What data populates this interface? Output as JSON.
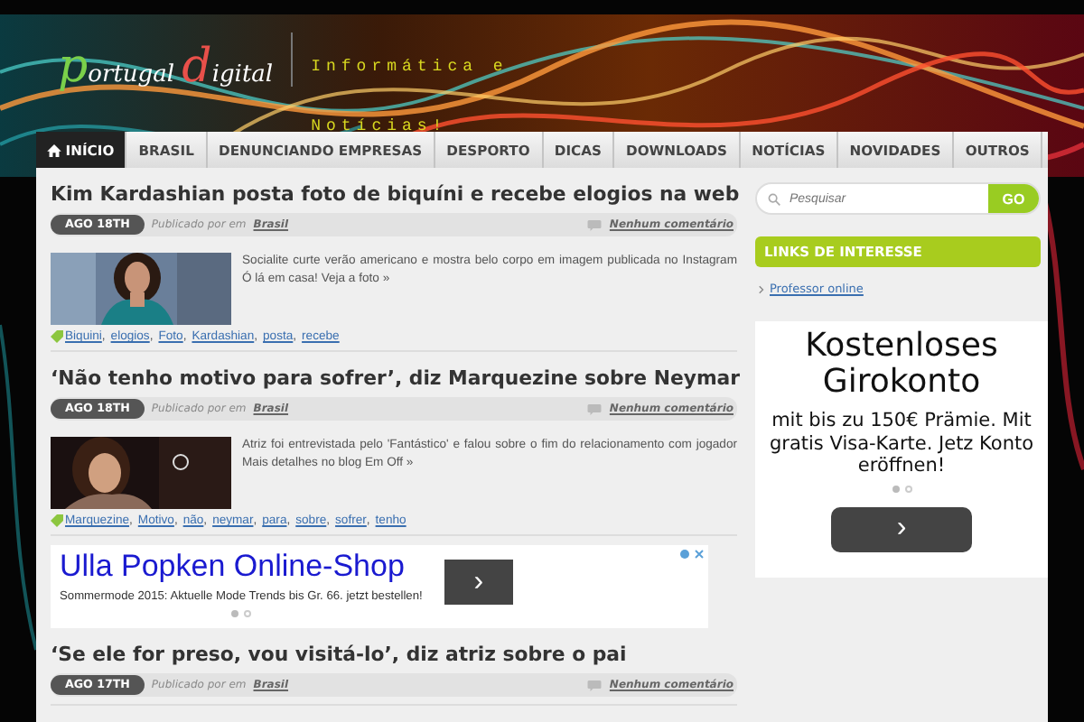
{
  "header": {
    "logo": {
      "word_1_initial": "p",
      "word_1_rest": "ortugal",
      "word_2_initial": "d",
      "word_2_rest": "igital"
    },
    "tagline": [
      "Informática e",
      "Notícias!"
    ]
  },
  "nav": [
    {
      "label": "INÍCIO",
      "selected": true,
      "kind": "home"
    },
    {
      "label": "BRASIL",
      "selected": false
    },
    {
      "label": "DENUNCIANDO EMPRESAS",
      "selected": false
    },
    {
      "label": "DESPORTO",
      "selected": false
    },
    {
      "label": "DICAS",
      "selected": false
    },
    {
      "label": "DOWNLOADS",
      "selected": false
    },
    {
      "label": "NOTÍCIAS",
      "selected": false
    },
    {
      "label": "NOVIDADES",
      "selected": false
    },
    {
      "label": "OUTROS",
      "selected": false
    }
  ],
  "posts": [
    {
      "kind": "post",
      "title": "Kim Kardashian posta foto de biquíni e recebe elogios na web",
      "date": "AGO 18TH",
      "byline": "Publicado por em",
      "category": "Brasil",
      "comments": "Nenhum comentário",
      "excerpt": "Socialite curte verão americano e mostra belo corpo em imagem publicada no Instagram Ó lá em casa! Veja a foto »",
      "tag_separator": ",",
      "tags": [
        "Biquini",
        "elogios",
        "Foto",
        "Kardashian",
        "posta",
        "recebe"
      ]
    },
    {
      "kind": "post",
      "title": "‘Não tenho motivo para sofrer’, diz Marquezine sobre Neymar",
      "date": "AGO 18TH",
      "byline": "Publicado por em",
      "category": "Brasil",
      "comments": "Nenhum comentário",
      "excerpt": "Atriz foi entrevistada pelo 'Fantástico' e falou sobre o fim do relacionamento com jogador Mais detalhes no blog Em Off »",
      "tag_separator": ",",
      "tags": [
        "Marquezine",
        "Motivo",
        "não",
        "neymar",
        "para",
        "sobre",
        "sofrer",
        "tenho"
      ]
    },
    {
      "kind": "ad",
      "title": "Ulla Popken Online-Shop",
      "text": "Sommermode 2015: Aktuelle Mode Trends bis Gr. 66. jetzt bestellen!",
      "button": "›",
      "dots": [
        {
          "selected": true
        },
        {
          "selected": false
        }
      ]
    },
    {
      "kind": "post",
      "title": "‘Se ele for preso, vou visitá-lo’, diz atriz sobre o pai",
      "date": "AGO 17TH",
      "byline": "Publicado por em",
      "category": "Brasil",
      "comments": "Nenhum comentário"
    }
  ],
  "sidebar": {
    "search": {
      "placeholder": "Pesquisar",
      "button": "GO"
    },
    "widget": {
      "title": "LINKS DE INTERESSE",
      "links": [
        "Professor online"
      ]
    },
    "ad": {
      "title": "Kostenloses Girokonto",
      "text": "mit bis zu 150€ Prämie. Mit gratis Visa-Karte. Jetz Konto eröffnen!",
      "button": "›",
      "dots": [
        {
          "selected": true
        },
        {
          "selected": false
        }
      ]
    }
  }
}
